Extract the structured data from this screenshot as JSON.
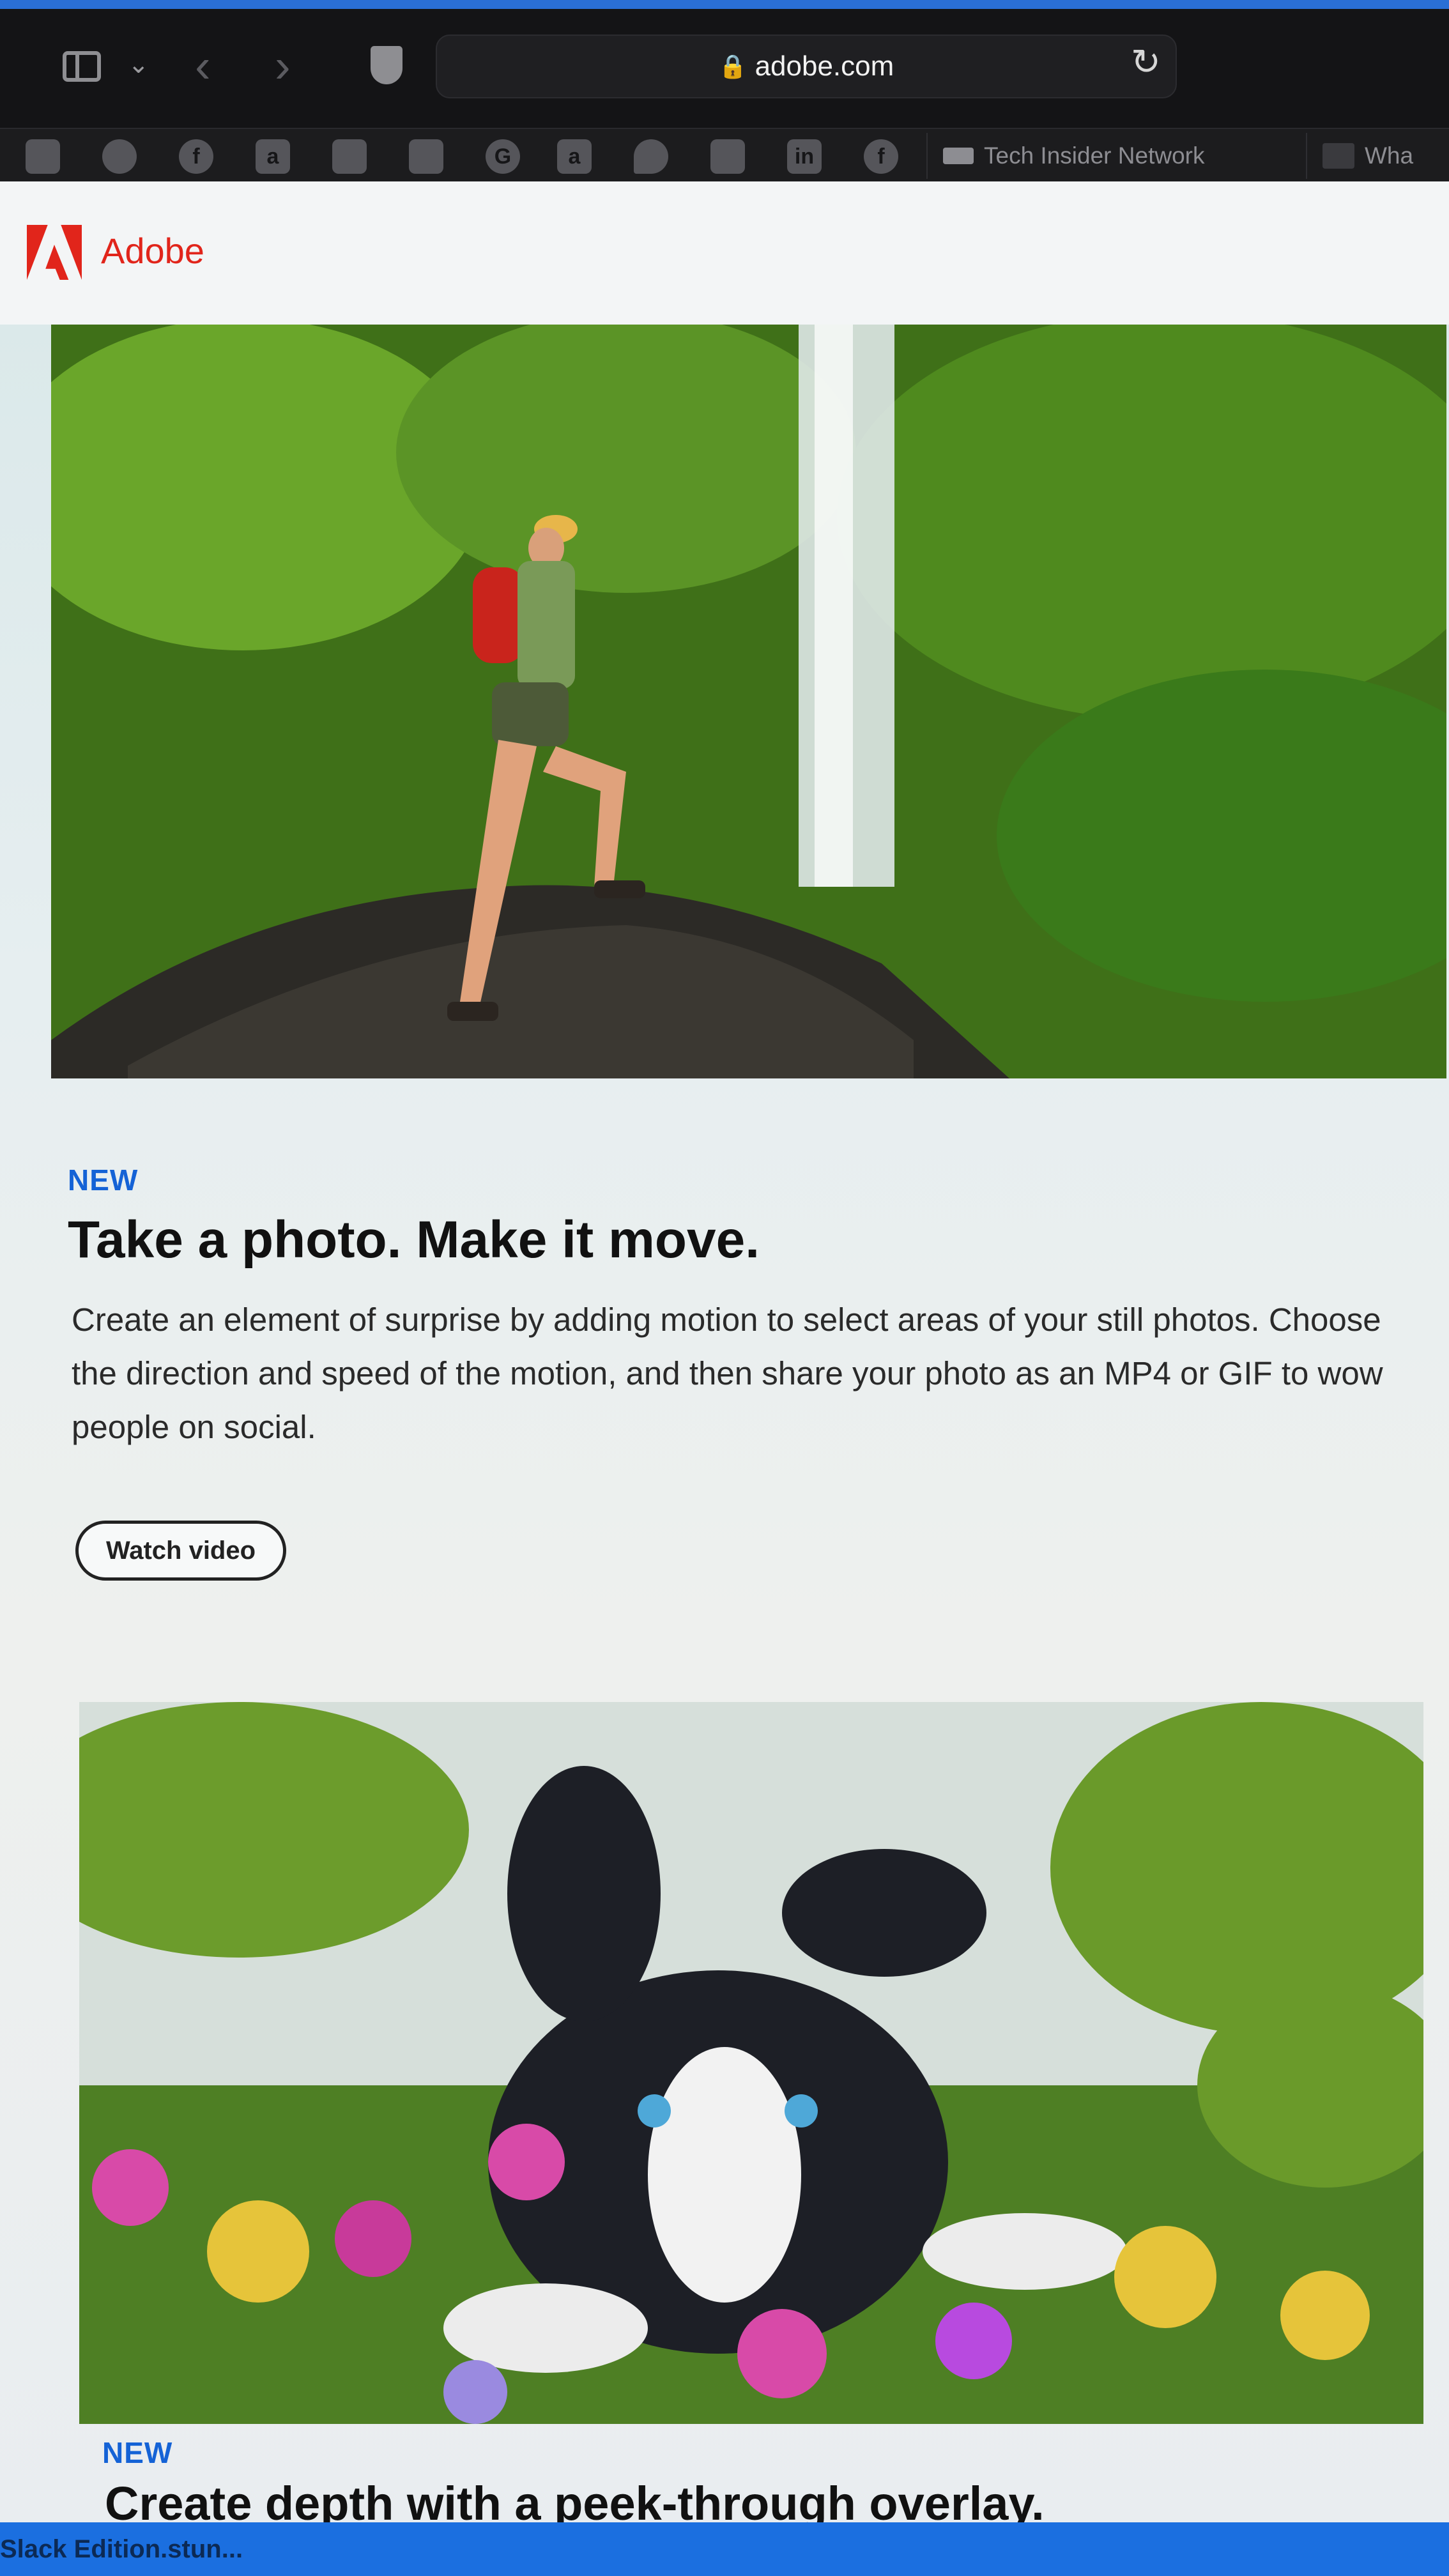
{
  "browser": {
    "address": "adobe.com",
    "favorites": [
      "a",
      "a",
      "in",
      "f"
    ],
    "favorites_tab_1": "Tech Insider Network",
    "favorites_tab_2": "Wha"
  },
  "brand": {
    "name": "Adobe",
    "color": "#e1251b"
  },
  "features": [
    {
      "label": "NEW",
      "title": "Take a photo. Make it move.",
      "body": "Create an element of surprise by adding motion to select areas of your still photos. Choose the direction and speed of the motion, and then share your photo as an MP4 or GIF to wow people on social.",
      "button": "Watch video"
    },
    {
      "label": "NEW",
      "title": "Create depth with a peek-through overlay."
    }
  ],
  "footer": {
    "text": "Slack Edition.stun..."
  },
  "colors": {
    "label_blue": "#1462d6",
    "os_bar": "#1b6fe0"
  }
}
